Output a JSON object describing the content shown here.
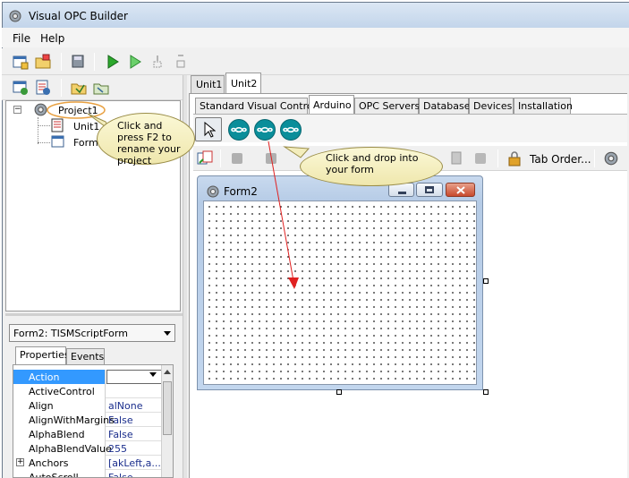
{
  "window": {
    "title": "Visual OPC Builder"
  },
  "menu": [
    "File",
    "Help"
  ],
  "tree": {
    "project": "Project1",
    "units": [
      "Unit1",
      "Form2"
    ]
  },
  "inspector": {
    "object": "Form2: TISMScriptForm",
    "tabs": [
      "Properties",
      "Events"
    ],
    "properties": [
      {
        "name": "Action",
        "value": ""
      },
      {
        "name": "ActiveControl",
        "value": ""
      },
      {
        "name": "Align",
        "value": "alNone"
      },
      {
        "name": "AlignWithMargins",
        "value": "False"
      },
      {
        "name": "AlphaBlend",
        "value": "False"
      },
      {
        "name": "AlphaBlendValue",
        "value": "255"
      },
      {
        "name": "Anchors",
        "value": "[akLeft,a..."
      },
      {
        "name": "AutoScroll",
        "value": "False"
      }
    ]
  },
  "file_tabs": [
    "Unit1",
    "Unit2"
  ],
  "palette_tabs": [
    "Standard Visual Controls",
    "Arduino",
    "OPC Servers",
    "Database",
    "Devices",
    "Installation"
  ],
  "designer": {
    "tab_order_label": "Tab Order..."
  },
  "form": {
    "title": "Form2"
  },
  "callouts": {
    "rename": "Click and press F2 to rename your project",
    "drop": "Click and drop into your form"
  },
  "colors": {
    "selection": "#3399ff",
    "arduino": "#0a8e9a",
    "callout": "#f3edbd",
    "arrow": "#e02020"
  }
}
